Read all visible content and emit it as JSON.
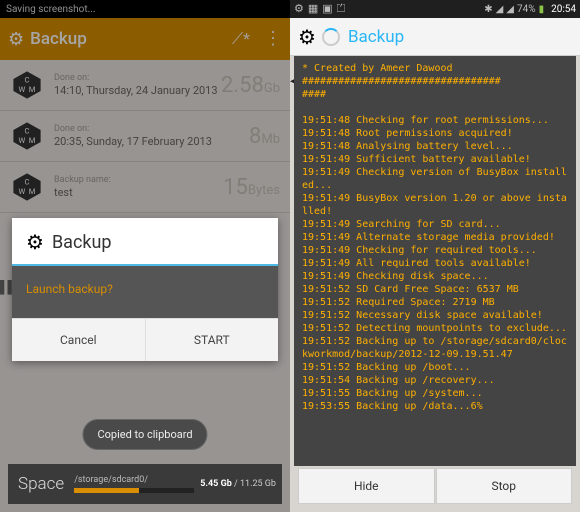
{
  "left": {
    "sysbar": "Saving screenshot...",
    "app_title": "Backup",
    "rows": [
      {
        "lbl": "Done on:",
        "val": "14:10, Thursday, 24 January 2013",
        "size": "2.58",
        "unit": "Gb"
      },
      {
        "lbl": "Done on:",
        "val": "20:35, Sunday, 17 February 2013",
        "size": "8",
        "unit": "Mb"
      },
      {
        "lbl": "Backup name:",
        "val": "test",
        "size": "15",
        "unit": "Bytes"
      }
    ],
    "dialog": {
      "title": "Backup",
      "body": "Launch backup?",
      "cancel": "Cancel",
      "start": "START"
    },
    "toast": "Copied to clipboard",
    "space": {
      "label": "Space",
      "path": "/storage/sdcard0/",
      "used": "5.45 Gb",
      "total": "11.25 Gb"
    }
  },
  "right": {
    "status": {
      "battery": "74%",
      "time": "20:54"
    },
    "title": "Backup",
    "log": "* Created by Ameer Dawood\n#################################\n####\n\n19:51:48 Checking for root permissions...\n19:51:48 Root permissions acquired!\n19:51:48 Analysing battery level...\n19:51:49 Sufficient battery available!\n19:51:49 Checking version of BusyBox installed...\n19:51:49 BusyBox version 1.20 or above installed!\n19:51:49 Searching for SD card...\n19:51:49 Alternate storage media provided!\n19:51:49 Checking for required tools...\n19:51:49 All required tools available!\n19:51:49 Checking disk space...\n19:51:52 SD Card Free Space: 6537 MB\n19:51:52 Required Space: 2719 MB\n19:51:52 Necessary disk space available!\n19:51:52 Detecting mountpoints to exclude...\n19:51:52 Backing up to /storage/sdcard0/clockworkmod/backup/2012-12-09.19.51.47\n19:51:52 Backing up /boot...\n19:51:54 Backing up /recovery...\n19:51:55 Backing up /system...\n19:53:55 Backing up /data...6%",
    "btn_hide": "Hide",
    "btn_stop": "Stop"
  }
}
